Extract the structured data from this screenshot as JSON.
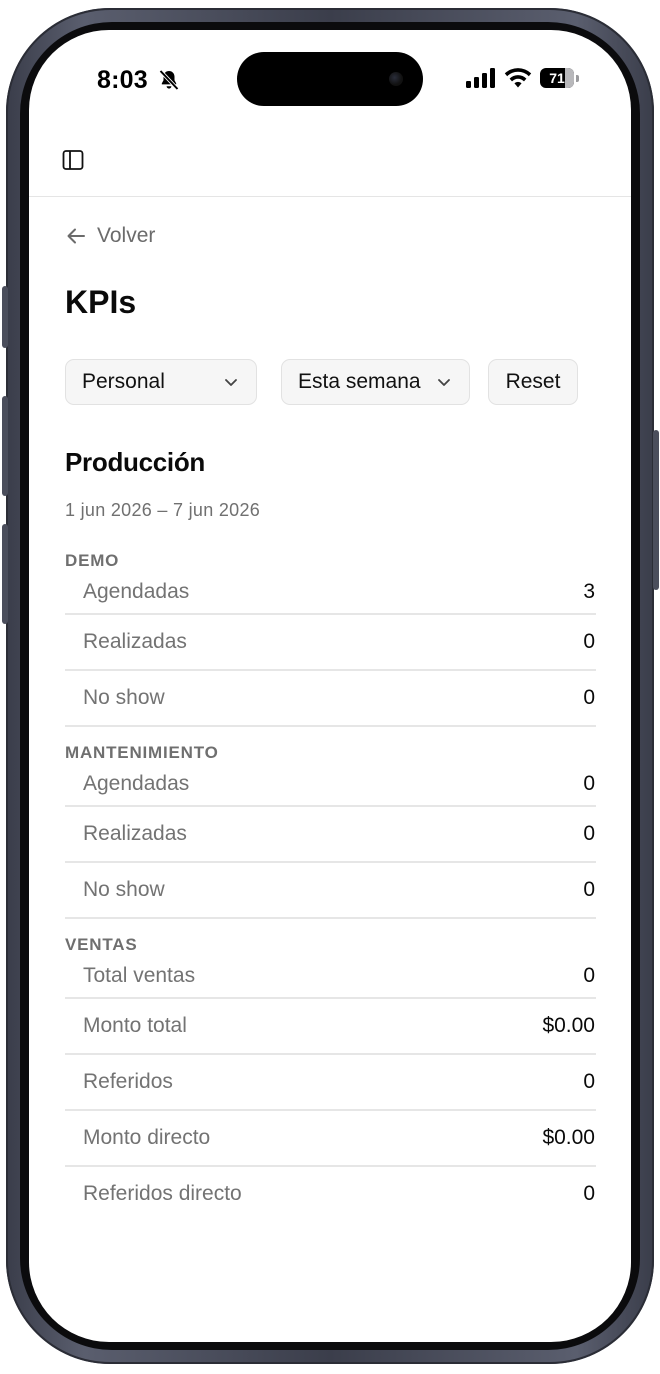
{
  "status_bar": {
    "time": "8:03",
    "battery": "71",
    "icons": [
      "bell-slash-icon",
      "cellular-signal-icon",
      "wifi-icon",
      "battery-icon"
    ]
  },
  "header": {
    "sidebar_icon": "sidebar-toggle-icon"
  },
  "nav": {
    "back_label": "Volver",
    "back_icon": "arrow-left-icon"
  },
  "page": {
    "title": "KPIs"
  },
  "filters": {
    "scope": "Personal",
    "period": "Esta semana",
    "reset_label": "Reset",
    "chevron_icon": "chevron-down-icon"
  },
  "section": {
    "title": "Producción",
    "date_range": "1 jun 2026 – 7 jun 2026"
  },
  "groups": [
    {
      "label": "DEMO",
      "rows": [
        {
          "name": "Agendadas",
          "value": "3"
        },
        {
          "name": "Realizadas",
          "value": "0"
        },
        {
          "name": "No show",
          "value": "0"
        }
      ]
    },
    {
      "label": "MANTENIMIENTO",
      "rows": [
        {
          "name": "Agendadas",
          "value": "0"
        },
        {
          "name": "Realizadas",
          "value": "0"
        },
        {
          "name": "No show",
          "value": "0"
        }
      ]
    },
    {
      "label": "VENTAS",
      "rows": [
        {
          "name": "Total ventas",
          "value": "0"
        },
        {
          "name": "Monto total",
          "value": "$0.00"
        },
        {
          "name": "Referidos",
          "value": "0"
        },
        {
          "name": "Monto directo",
          "value": "$0.00"
        },
        {
          "name": "Referidos directo",
          "value": "0"
        }
      ]
    }
  ],
  "colors": {
    "frame": "#3b3e4b",
    "text_primary": "#0a0a0a",
    "text_muted": "#737373",
    "divider": "#e6e6e6",
    "control_bg": "#f6f6f6"
  }
}
